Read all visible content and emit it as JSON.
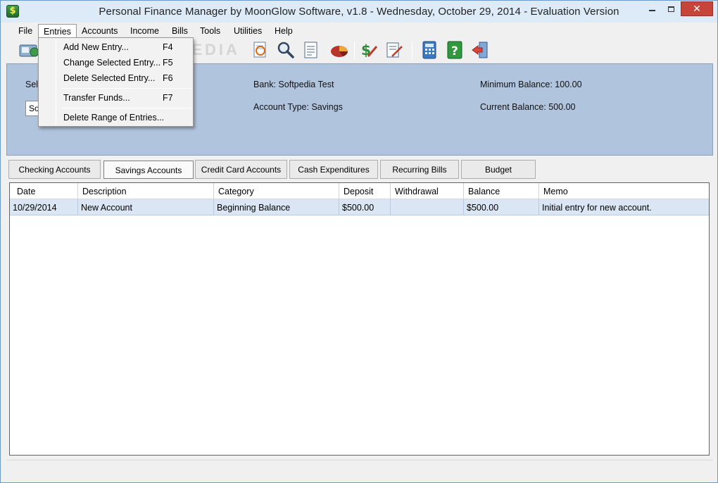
{
  "window": {
    "title": "Personal Finance Manager by MoonGlow Software, v1.8  -  Wednesday, October 29, 2014  -  Evaluation Version",
    "app_icon_glyph": "$",
    "close_glyph": "✕"
  },
  "menubar": {
    "items": [
      "File",
      "Entries",
      "Accounts",
      "Income",
      "Bills",
      "Tools",
      "Utilities",
      "Help"
    ]
  },
  "toolbar": {
    "icons": [
      "accounts-icon",
      "document-magnify-icon",
      "search-icon",
      "report-icon",
      "pie-chart-icon",
      "dollar-pencil-icon",
      "edit-document-icon",
      "calculator-icon",
      "help-icon",
      "exit-door-icon"
    ]
  },
  "watermark": "SOFTPEDIA",
  "entries_menu": {
    "items": [
      {
        "label": "Add New Entry...",
        "shortcut": "F4"
      },
      {
        "label": "Change Selected Entry...",
        "shortcut": "F5"
      },
      {
        "label": "Delete Selected Entry...",
        "shortcut": "F6"
      },
      {
        "label": "Transfer Funds...",
        "shortcut": "F7"
      },
      {
        "label": "Delete Range of Entries...",
        "shortcut": ""
      }
    ]
  },
  "account_panel": {
    "select_label_partial": "Sel",
    "select_value_partial": "Sof",
    "bank": "Bank:  Softpedia Test",
    "account_type": "Account Type:  Savings",
    "minimum_balance": "Minimum Balance:  100.00",
    "current_balance": "Current Balance:  500.00"
  },
  "tabs": [
    "Checking Accounts",
    "Savings Accounts",
    "Credit Card Accounts",
    "Cash Expenditures",
    "Recurring Bills",
    "Budget"
  ],
  "selected_tab": "Savings Accounts",
  "grid": {
    "columns": [
      "Date",
      "Description",
      "Category",
      "Deposit",
      "Withdrawal",
      "Balance",
      "Memo"
    ],
    "rows": [
      [
        "10/29/2014",
        "New Account",
        "Beginning Balance",
        "$500.00",
        "",
        "$500.00",
        "Initial entry for new account."
      ]
    ]
  },
  "colors": {
    "panel_bg": "#b1c4dd",
    "row_selected_bg": "#dbe6f4",
    "titlebar_bg": "#dcebf7",
    "close_button": "#c7443b"
  }
}
